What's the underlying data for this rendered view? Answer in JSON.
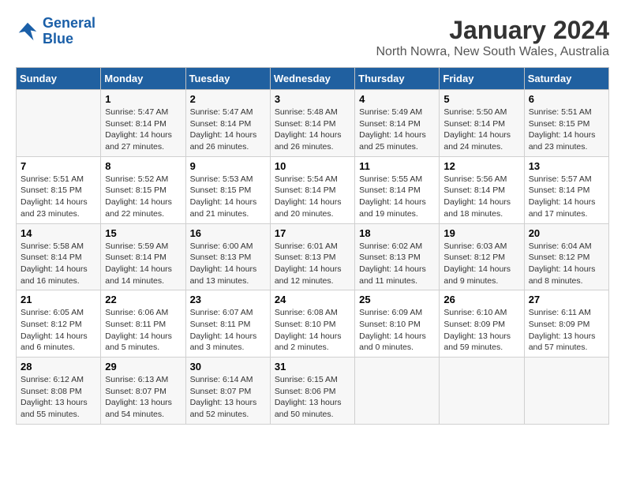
{
  "header": {
    "logo_line1": "General",
    "logo_line2": "Blue",
    "title": "January 2024",
    "subtitle": "North Nowra, New South Wales, Australia"
  },
  "days_of_week": [
    "Sunday",
    "Monday",
    "Tuesday",
    "Wednesday",
    "Thursday",
    "Friday",
    "Saturday"
  ],
  "weeks": [
    [
      {
        "day": "",
        "info": ""
      },
      {
        "day": "1",
        "info": "Sunrise: 5:47 AM\nSunset: 8:14 PM\nDaylight: 14 hours\nand 27 minutes."
      },
      {
        "day": "2",
        "info": "Sunrise: 5:47 AM\nSunset: 8:14 PM\nDaylight: 14 hours\nand 26 minutes."
      },
      {
        "day": "3",
        "info": "Sunrise: 5:48 AM\nSunset: 8:14 PM\nDaylight: 14 hours\nand 26 minutes."
      },
      {
        "day": "4",
        "info": "Sunrise: 5:49 AM\nSunset: 8:14 PM\nDaylight: 14 hours\nand 25 minutes."
      },
      {
        "day": "5",
        "info": "Sunrise: 5:50 AM\nSunset: 8:14 PM\nDaylight: 14 hours\nand 24 minutes."
      },
      {
        "day": "6",
        "info": "Sunrise: 5:51 AM\nSunset: 8:15 PM\nDaylight: 14 hours\nand 23 minutes."
      }
    ],
    [
      {
        "day": "7",
        "info": "Sunrise: 5:51 AM\nSunset: 8:15 PM\nDaylight: 14 hours\nand 23 minutes."
      },
      {
        "day": "8",
        "info": "Sunrise: 5:52 AM\nSunset: 8:15 PM\nDaylight: 14 hours\nand 22 minutes."
      },
      {
        "day": "9",
        "info": "Sunrise: 5:53 AM\nSunset: 8:15 PM\nDaylight: 14 hours\nand 21 minutes."
      },
      {
        "day": "10",
        "info": "Sunrise: 5:54 AM\nSunset: 8:14 PM\nDaylight: 14 hours\nand 20 minutes."
      },
      {
        "day": "11",
        "info": "Sunrise: 5:55 AM\nSunset: 8:14 PM\nDaylight: 14 hours\nand 19 minutes."
      },
      {
        "day": "12",
        "info": "Sunrise: 5:56 AM\nSunset: 8:14 PM\nDaylight: 14 hours\nand 18 minutes."
      },
      {
        "day": "13",
        "info": "Sunrise: 5:57 AM\nSunset: 8:14 PM\nDaylight: 14 hours\nand 17 minutes."
      }
    ],
    [
      {
        "day": "14",
        "info": "Sunrise: 5:58 AM\nSunset: 8:14 PM\nDaylight: 14 hours\nand 16 minutes."
      },
      {
        "day": "15",
        "info": "Sunrise: 5:59 AM\nSunset: 8:14 PM\nDaylight: 14 hours\nand 14 minutes."
      },
      {
        "day": "16",
        "info": "Sunrise: 6:00 AM\nSunset: 8:13 PM\nDaylight: 14 hours\nand 13 minutes."
      },
      {
        "day": "17",
        "info": "Sunrise: 6:01 AM\nSunset: 8:13 PM\nDaylight: 14 hours\nand 12 minutes."
      },
      {
        "day": "18",
        "info": "Sunrise: 6:02 AM\nSunset: 8:13 PM\nDaylight: 14 hours\nand 11 minutes."
      },
      {
        "day": "19",
        "info": "Sunrise: 6:03 AM\nSunset: 8:12 PM\nDaylight: 14 hours\nand 9 minutes."
      },
      {
        "day": "20",
        "info": "Sunrise: 6:04 AM\nSunset: 8:12 PM\nDaylight: 14 hours\nand 8 minutes."
      }
    ],
    [
      {
        "day": "21",
        "info": "Sunrise: 6:05 AM\nSunset: 8:12 PM\nDaylight: 14 hours\nand 6 minutes."
      },
      {
        "day": "22",
        "info": "Sunrise: 6:06 AM\nSunset: 8:11 PM\nDaylight: 14 hours\nand 5 minutes."
      },
      {
        "day": "23",
        "info": "Sunrise: 6:07 AM\nSunset: 8:11 PM\nDaylight: 14 hours\nand 3 minutes."
      },
      {
        "day": "24",
        "info": "Sunrise: 6:08 AM\nSunset: 8:10 PM\nDaylight: 14 hours\nand 2 minutes."
      },
      {
        "day": "25",
        "info": "Sunrise: 6:09 AM\nSunset: 8:10 PM\nDaylight: 14 hours\nand 0 minutes."
      },
      {
        "day": "26",
        "info": "Sunrise: 6:10 AM\nSunset: 8:09 PM\nDaylight: 13 hours\nand 59 minutes."
      },
      {
        "day": "27",
        "info": "Sunrise: 6:11 AM\nSunset: 8:09 PM\nDaylight: 13 hours\nand 57 minutes."
      }
    ],
    [
      {
        "day": "28",
        "info": "Sunrise: 6:12 AM\nSunset: 8:08 PM\nDaylight: 13 hours\nand 55 minutes."
      },
      {
        "day": "29",
        "info": "Sunrise: 6:13 AM\nSunset: 8:07 PM\nDaylight: 13 hours\nand 54 minutes."
      },
      {
        "day": "30",
        "info": "Sunrise: 6:14 AM\nSunset: 8:07 PM\nDaylight: 13 hours\nand 52 minutes."
      },
      {
        "day": "31",
        "info": "Sunrise: 6:15 AM\nSunset: 8:06 PM\nDaylight: 13 hours\nand 50 minutes."
      },
      {
        "day": "",
        "info": ""
      },
      {
        "day": "",
        "info": ""
      },
      {
        "day": "",
        "info": ""
      }
    ]
  ]
}
